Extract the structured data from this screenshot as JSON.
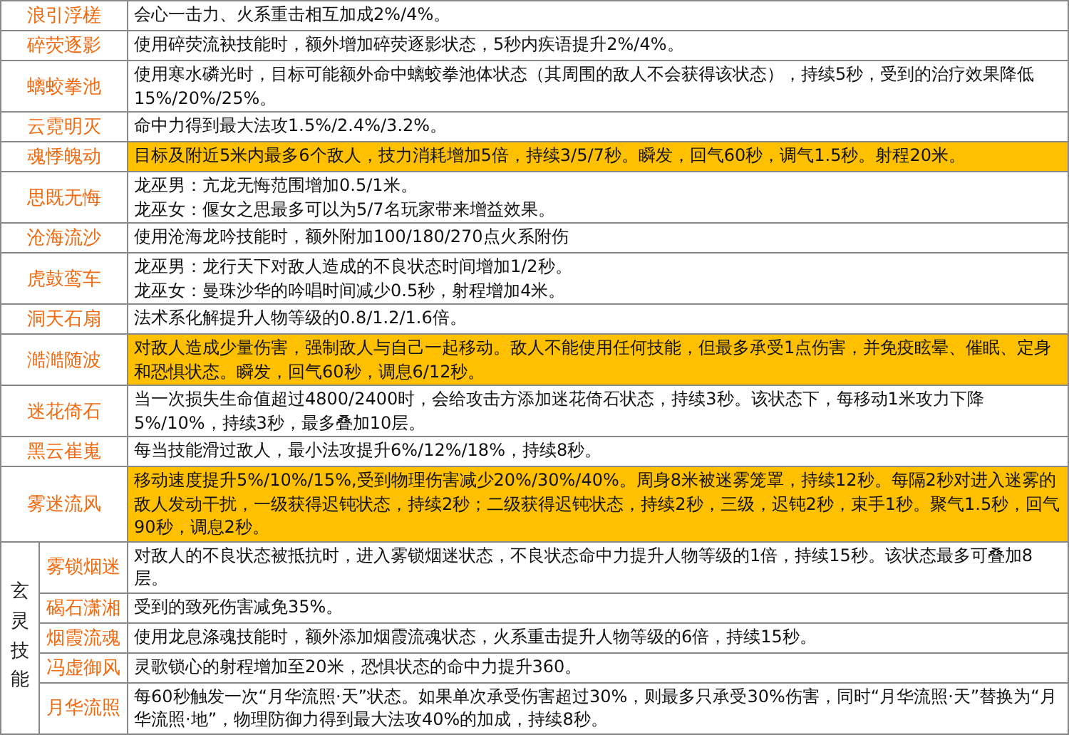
{
  "rows": [
    {
      "name": "浪引浮槎",
      "highlighted": false,
      "description": [
        "会心一击力、火系重击相互加成2%/4%。"
      ]
    },
    {
      "name": "碎荧逐影",
      "highlighted": false,
      "description": [
        "使用碎荧流袂技能时，额外增加碎荧逐影状态，5秒内疾语提升2%/4%。"
      ]
    },
    {
      "name": "螭蛟拳池",
      "highlighted": false,
      "description": [
        "使用寒水磷光时，目标可能额外命中螭蛟拳池体状态（其周围的敌人不会获得该状态），持续5秒，受到的治疗效果降低15%/20%/25%。"
      ]
    },
    {
      "name": "云霓明灭",
      "highlighted": false,
      "description": [
        "命中力得到最大法攻1.5%/2.4%/3.2%。"
      ]
    },
    {
      "name": "魂悸魄动",
      "highlighted": true,
      "description": [
        "目标及附近5米内最多6个敌人，技力消耗增加5倍，持续3/5/7秒。瞬发，回气60秒，调气1.5秒。射程20米。"
      ]
    },
    {
      "name": "思既无悔",
      "highlighted": false,
      "description": [
        "龙巫男：亢龙无悔范围增加0.5/1米。",
        "龙巫女：偃女之思最多可以为5/7名玩家带来增益效果。"
      ]
    },
    {
      "name": "沧海流沙",
      "highlighted": false,
      "description": [
        "使用沧海龙吟技能时，额外附加100/180/270点火系附伤"
      ]
    },
    {
      "name": "虎鼓鸾车",
      "highlighted": false,
      "description": [
        "龙巫男：龙行天下对敌人造成的不良状态时间增加1/2秒。",
        "龙巫女：曼珠沙华的吟唱时间减少0.5秒，射程增加4米。"
      ]
    },
    {
      "name": "洞天石扇",
      "highlighted": false,
      "description": [
        "法术系化解提升人物等级的0.8/1.2/1.6倍。"
      ]
    },
    {
      "name": "澔澔随波",
      "highlighted": true,
      "description": [
        "对敌人造成少量伤害，强制敌人与自己一起移动。敌人不能使用任何技能，但最多承受1点伤害，并免疫眩晕、催眠、定身和恐惧状态。瞬发，回气60秒，调息6/12秒。"
      ]
    },
    {
      "name": "迷花倚石",
      "highlighted": false,
      "description": [
        "当一次损失生命值超过4800/2400时，会给攻击方添加迷花倚石状态，持续3秒。该状态下，每移动1米攻力下降5%/10%，持续3秒，最多叠加10层。"
      ]
    },
    {
      "name": "黑云崔嵬",
      "highlighted": false,
      "description": [
        "每当技能滑过敌人，最小法攻提升6%/12%/18%，持续8秒。"
      ]
    },
    {
      "name": "雾迷流风",
      "highlighted": true,
      "description": [
        "移动速度提升5%/10%/15%,受到物理伤害减少20%/30%/40%。周身8米被迷雾笼罩，持续12秒。每隔2秒对进入迷雾的敌人发动干扰，一级获得迟钝状态，持续2秒；二级获得迟钝状态，持续2秒，三级，迟钝2秒，束手1秒。聚气1.5秒，回气90秒，调息2秒。"
      ]
    }
  ],
  "group": {
    "label": "玄灵技能",
    "rows": [
      {
        "name": "雾锁烟迷",
        "highlighted": false,
        "description": [
          "对敌人的不良状态被抵抗时，进入雾锁烟迷状态，不良状态命中力提升人物等级的1倍，持续15秒。该状态最多可叠加8层。"
        ]
      },
      {
        "name": "碣石潇湘",
        "highlighted": false,
        "description": [
          "受到的致死伤害减免35%。"
        ]
      },
      {
        "name": "烟霞流魂",
        "highlighted": false,
        "description": [
          "使用龙息涤魂技能时，额外添加烟霞流魂状态，火系重击提升人物等级的6倍，持续15秒。"
        ]
      },
      {
        "name": "冯虚御风",
        "highlighted": false,
        "description": [
          "灵歌锁心的射程增加至20米，恐惧状态的命中力提升360。"
        ]
      },
      {
        "name": "月华流照",
        "highlighted": false,
        "description": [
          "每60秒触发一次“月华流照·天”状态。如果单次承受伤害超过30%，则最多只承受30%伤害，同时“月华流照·天”替换为“月华流照·地”，物理防御力得到最大法攻40%的加成，持续8秒。"
        ]
      }
    ]
  }
}
